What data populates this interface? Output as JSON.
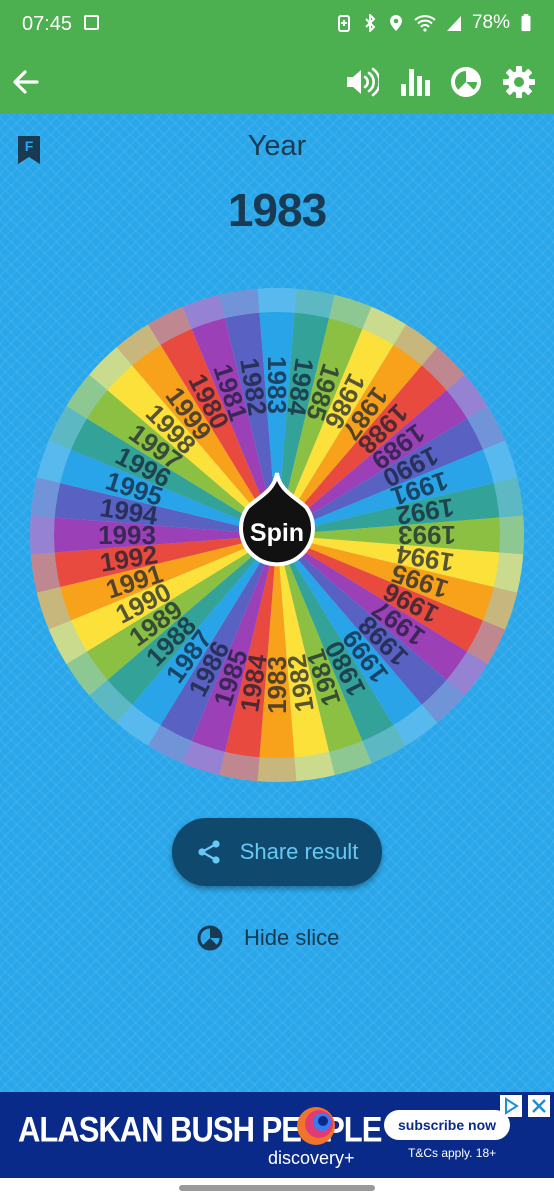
{
  "status_bar": {
    "time": "07:45",
    "battery": "78%",
    "icons": [
      "photo-icon",
      "battery-saver-icon",
      "bluetooth-icon",
      "location-icon",
      "wifi-icon",
      "signal-icon",
      "battery-icon"
    ]
  },
  "app_bar": {
    "background": "#4caf50",
    "icons": [
      "back-arrow-icon",
      "volume-icon",
      "stats-icon",
      "pie-chart-icon",
      "settings-gear-icon"
    ]
  },
  "header": {
    "bookmark_letter": "F",
    "label": "Year",
    "result": "1983"
  },
  "wheel": {
    "center_label": "Spin",
    "slices": [
      "1980",
      "1981",
      "1982",
      "1983",
      "1984",
      "1985",
      "1986",
      "1987",
      "1988",
      "1989",
      "1990",
      "1991",
      "1992",
      "1993",
      "1994",
      "1995",
      "1996",
      "1997",
      "1998",
      "1999"
    ],
    "colors": [
      "#e84a3f",
      "#9c40b8",
      "#5961c2",
      "#29a4e8",
      "#33a39a",
      "#8cc043",
      "#fde13b",
      "#f8a11a"
    ]
  },
  "actions": {
    "share_label": "Share result",
    "hide_slice_label": "Hide slice"
  },
  "ad": {
    "title": "ALASKAN BUSH PEOPLE",
    "brand": "discovery+",
    "cta": "subscribe now",
    "terms": "T&Cs apply. 18+",
    "background": "#0a2a8a"
  }
}
